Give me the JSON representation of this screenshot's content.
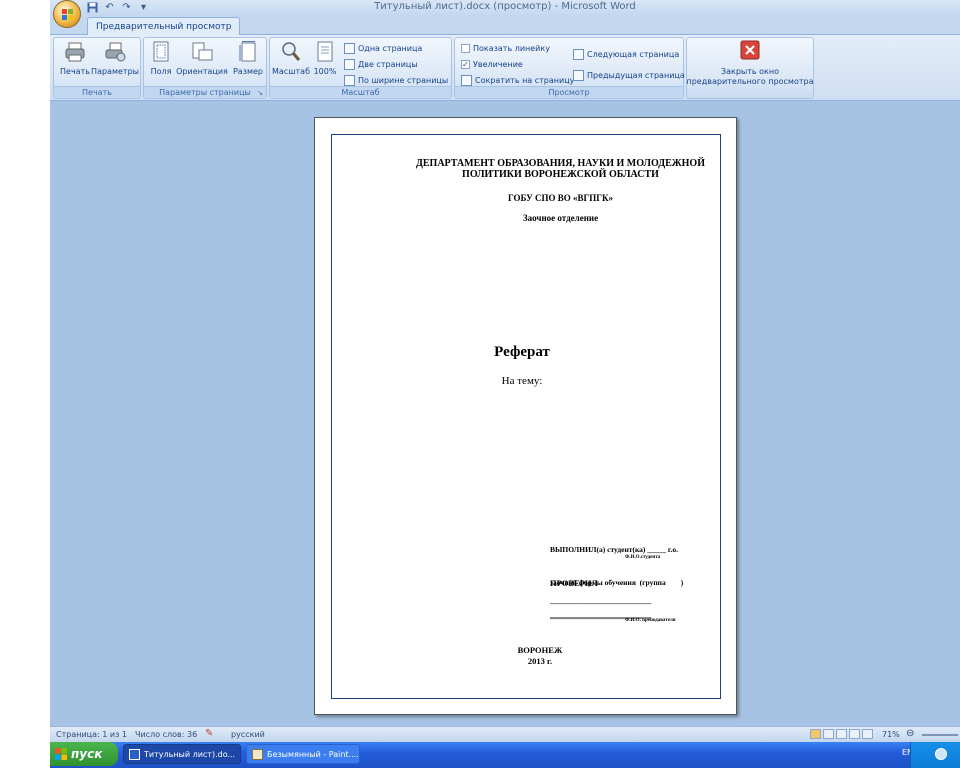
{
  "window": {
    "title": "Титульный лист).docx (просмотр) - Microsoft Word"
  },
  "tabs": [
    {
      "label": "Предварительный просмотр"
    }
  ],
  "ribbon": {
    "print_group": {
      "label": "Печать",
      "print": "Печать",
      "options": "Параметры"
    },
    "page_setup_group": {
      "label": "Параметры страницы",
      "margins": "Поля",
      "orientation": "Ориентация",
      "size": "Размер"
    },
    "zoom_group": {
      "label": "Масштаб",
      "zoom": "Масштаб",
      "zoom100": "100%",
      "one_page": "Одна страница",
      "two_pages": "Две страницы",
      "page_width": "По ширине страницы"
    },
    "preview_group": {
      "label": "Просмотр",
      "show_ruler": "Показать линейку",
      "show_ruler_checked": false,
      "magnifier": "Увеличение",
      "magnifier_checked": true,
      "shrink": "Сократить на страницу",
      "next_page": "Следующая страница",
      "prev_page": "Предыдущая страница"
    },
    "close_preview": {
      "line1": "Закрыть окно",
      "line2": "предварительного просмотра"
    }
  },
  "document": {
    "header_line1": "ДЕПАРТАМЕНТ ОБРАЗОВАНИЯ, НАУКИ И МОЛОДЕЖНОЙ",
    "header_line2": "ПОЛИТИКИ ВОРОНЕЖСКОЙ ОБЛАСТИ",
    "institution": "ГОБУ СПО ВО «ВГПГК»",
    "department": "Заочное отделение",
    "title": "Реферат",
    "topic": "На тему:",
    "performed_line1": "ВЫПОЛНИЛ(а) студент(ка) _____ г.о.",
    "performed_line2": "заочной формы обучения  (группа        )",
    "student_name_line": "___________________________",
    "student_caption": "Ф.И.О.студента",
    "checked": "ПРОВЕРИЛ",
    "teacher_line1": "___________________________",
    "teacher_line2": "___________________________",
    "teacher_caption": "Ф.И.О. преподавателя",
    "city": "ВОРОНЕЖ",
    "year": "2013 г."
  },
  "statusbar": {
    "page": "Страница: 1 из 1",
    "words": "Число слов: 36",
    "language": "русский",
    "zoom": "71%"
  },
  "taskbar": {
    "start": "пуск",
    "tasks": [
      {
        "label": "Титульный лист).do..."
      },
      {
        "label": "Безымянный - Paint...."
      }
    ],
    "lang": "EN"
  }
}
